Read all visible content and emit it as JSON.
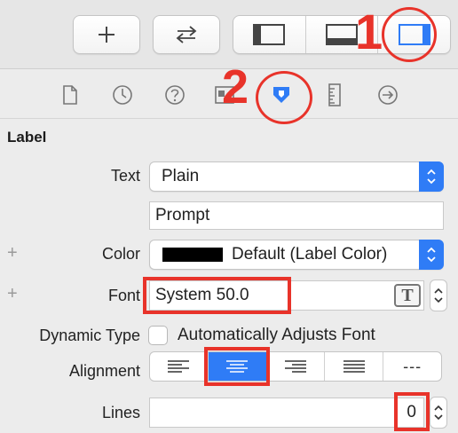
{
  "toolbar": {
    "buttons": [
      {
        "name": "add-button",
        "icon": "plus-icon"
      },
      {
        "name": "swap-button",
        "icon": "swap-arrows-icon"
      }
    ],
    "panel_toggles": [
      {
        "name": "toggle-navigator",
        "icon": "left-panel-icon"
      },
      {
        "name": "toggle-debug-area",
        "icon": "bottom-panel-icon"
      },
      {
        "name": "toggle-inspectors",
        "icon": "right-panel-icon",
        "active": true
      }
    ]
  },
  "inspector_tabs": [
    {
      "name": "file-inspector",
      "icon": "document-icon"
    },
    {
      "name": "history-inspector",
      "icon": "clock-icon"
    },
    {
      "name": "quick-help-inspector",
      "icon": "help-icon"
    },
    {
      "name": "identity-inspector",
      "icon": "identity-icon"
    },
    {
      "name": "attributes-inspector",
      "icon": "attributes-icon",
      "active": true
    },
    {
      "name": "size-inspector",
      "icon": "ruler-icon"
    },
    {
      "name": "connections-inspector",
      "icon": "arrow-circle-icon"
    }
  ],
  "annotations": {
    "one": "1",
    "two": "2"
  },
  "section": {
    "title": "Label"
  },
  "rows": {
    "text": {
      "label": "Text",
      "value": "Plain"
    },
    "prompt": {
      "value": "Prompt"
    },
    "color": {
      "label": "Color",
      "value": "Default (Label Color)"
    },
    "font": {
      "label": "Font",
      "value": "System 50.0"
    },
    "dynamic_type": {
      "label": "Dynamic Type",
      "checkbox_label": "Automatically Adjusts Font",
      "checked": false
    },
    "alignment": {
      "label": "Alignment",
      "selected": "center",
      "options": [
        "left",
        "center",
        "right",
        "justified",
        "natural"
      ],
      "natural_glyph": "---"
    },
    "lines": {
      "label": "Lines",
      "value": "0"
    }
  },
  "plus_glyph": "+",
  "font_button_glyph": "T",
  "colors": {
    "accent": "#2f7cf6",
    "annotation": "#e8332a"
  }
}
